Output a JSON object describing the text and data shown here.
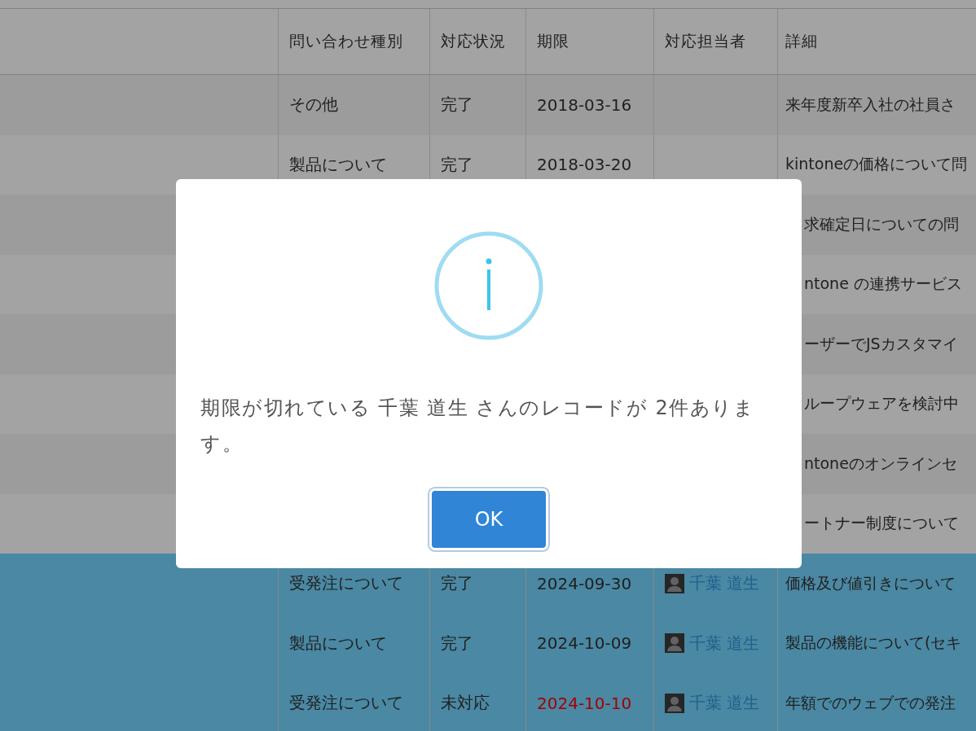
{
  "table": {
    "columns": [
      "問い合わせ種別",
      "対応状況",
      "期限",
      "対応担当者",
      "詳細"
    ],
    "rows": [
      {
        "category": "その他",
        "status": "完了",
        "due": "2018-03-16",
        "detail": "来年度新卒入社の社員さ",
        "highlighted": false,
        "overdue": false
      },
      {
        "category": "製品について",
        "status": "完了",
        "due": "2018-03-20",
        "detail": "kintoneの価格について問",
        "highlighted": false,
        "overdue": false
      },
      {
        "detail": "求確定日についての問",
        "highlighted": false
      },
      {
        "detail": "ntone の連携サービス",
        "highlighted": false
      },
      {
        "detail": "ーザーでJSカスタマイ",
        "highlighted": false
      },
      {
        "detail": "ループウェアを検討中",
        "highlighted": false
      },
      {
        "detail": "ntoneのオンラインセ",
        "highlighted": false
      },
      {
        "detail": "ートナー制度について",
        "highlighted": false
      },
      {
        "category": "受発注について",
        "status": "完了",
        "due": "2024-09-30",
        "assignee": "千葉 道生",
        "detail": "価格及び値引きについて",
        "highlighted": true,
        "overdue": false
      },
      {
        "category": "製品について",
        "status": "完了",
        "due": "2024-10-09",
        "assignee": "千葉 道生",
        "detail": "製品の機能について(セキ",
        "highlighted": true,
        "overdue": false
      },
      {
        "category": "受発注について",
        "status": "未対応",
        "due": "2024-10-10",
        "assignee": "千葉 道生",
        "detail": "年額でのウェブでの発注",
        "highlighted": true,
        "overdue": true
      }
    ]
  },
  "dialog": {
    "message": "期限が切れている 千葉 道生 さんのレコードが 2件あります。",
    "button": "OK"
  }
}
